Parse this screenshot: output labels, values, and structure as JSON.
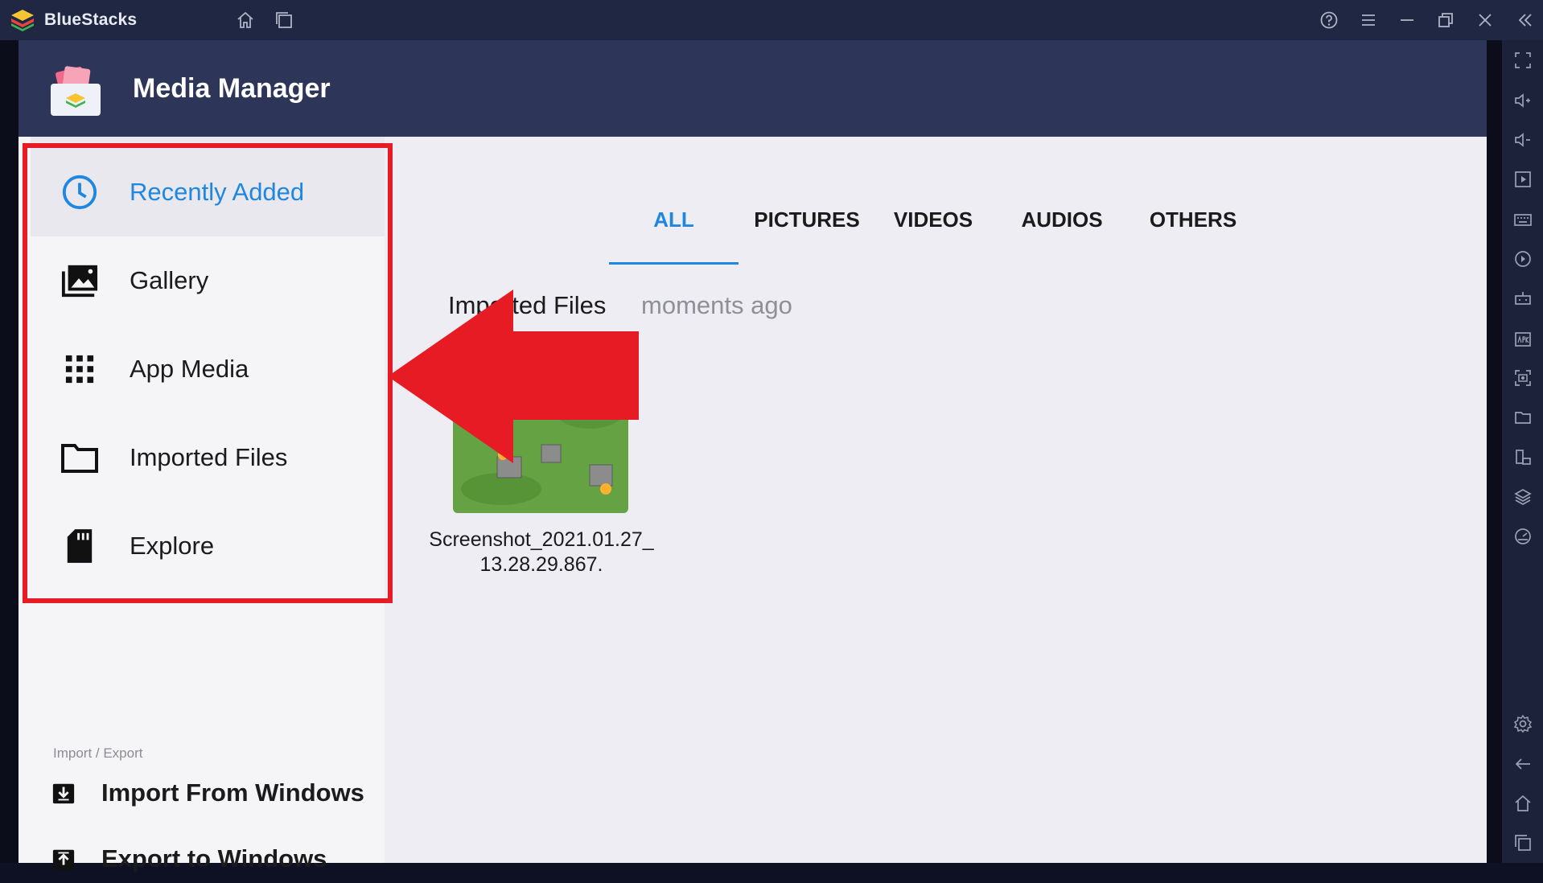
{
  "window": {
    "app_name": "BlueStacks"
  },
  "app": {
    "title": "Media Manager"
  },
  "sidebar": {
    "items": [
      {
        "label": "Recently Added",
        "icon": "clock-icon",
        "selected": true
      },
      {
        "label": "Gallery",
        "icon": "gallery-icon",
        "selected": false
      },
      {
        "label": "App Media",
        "icon": "grid-icon",
        "selected": false
      },
      {
        "label": "Imported Files",
        "icon": "folder-icon",
        "selected": false
      },
      {
        "label": "Explore",
        "icon": "sd-card-icon",
        "selected": false
      }
    ],
    "section_label": "Import / Export",
    "actions": [
      {
        "label": "Import From Windows",
        "icon": "import-icon"
      },
      {
        "label": "Export to Windows",
        "icon": "export-icon"
      }
    ]
  },
  "tabs": [
    {
      "label": "ALL",
      "active": true
    },
    {
      "label": "PICTURES",
      "active": false
    },
    {
      "label": "VIDEOS",
      "active": false
    },
    {
      "label": "AUDIOS",
      "active": false
    },
    {
      "label": "OTHERS",
      "active": false
    }
  ],
  "content": {
    "group_title": "Imported Files",
    "group_time": "moments ago",
    "files": [
      {
        "name": "Screenshot_2021.01.27_13.28.29.867."
      }
    ]
  },
  "colors": {
    "accent": "#1f87e0",
    "header": "#2d3558",
    "titlebar": "#1f2742",
    "annotation_red": "#e61b23"
  }
}
